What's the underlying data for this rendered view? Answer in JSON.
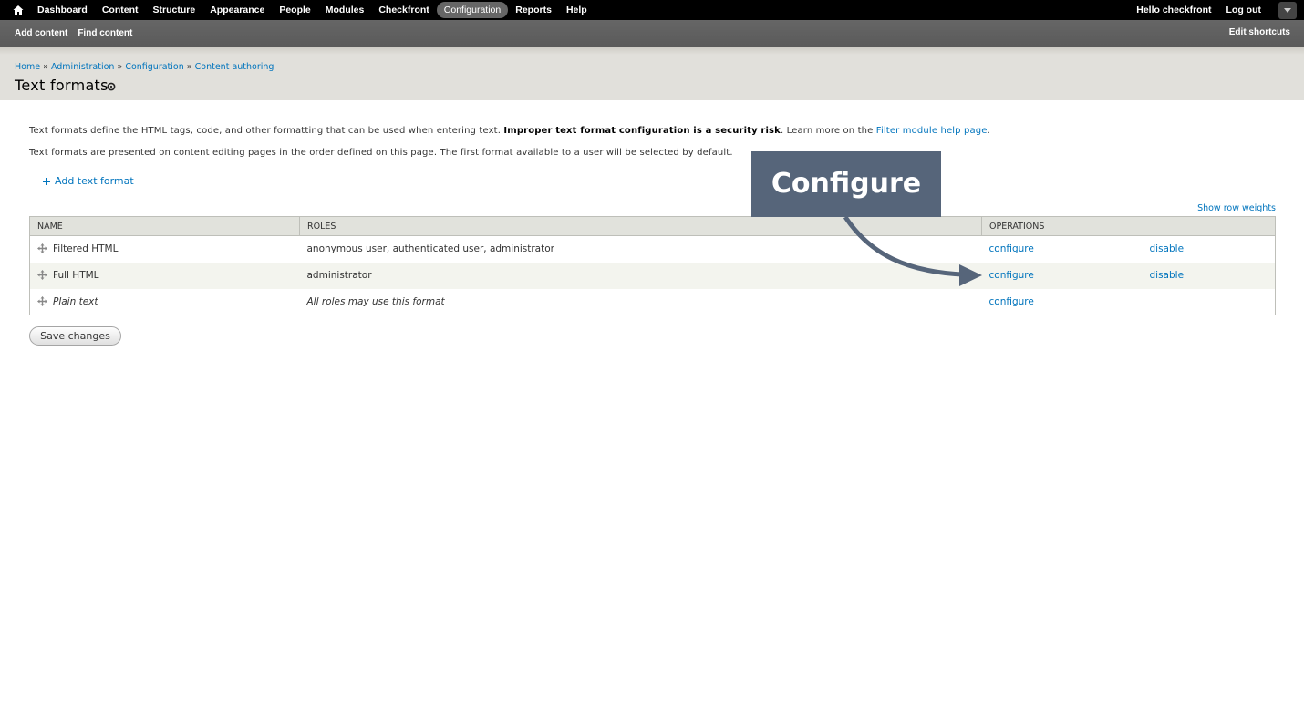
{
  "toolbar": {
    "menu": [
      "Dashboard",
      "Content",
      "Structure",
      "Appearance",
      "People",
      "Modules",
      "Checkfront",
      "Configuration",
      "Reports",
      "Help"
    ],
    "active": "Configuration",
    "hello_prefix": "Hello ",
    "username": "checkfront",
    "logout": "Log out"
  },
  "shortcuts": {
    "add_content": "Add content",
    "find_content": "Find content",
    "edit_shortcuts": "Edit shortcuts"
  },
  "breadcrumb": {
    "items": [
      "Home",
      "Administration",
      "Configuration",
      "Content authoring"
    ],
    "separator": "»"
  },
  "page_title": "Text formats",
  "description": {
    "line1_a": "Text formats define the HTML tags, code, and other formatting that can be used when entering text. ",
    "line1_bold": "Improper text format configuration is a security risk",
    "line1_b": ". Learn more on the ",
    "line1_link": "Filter module help page",
    "line1_c": ".",
    "line2": "Text formats are presented on content editing pages in the order defined on this page. The first format available to a user will be selected by default."
  },
  "add_text_format": "Add text format",
  "show_row_weights": "Show row weights",
  "table": {
    "headers": [
      "Name",
      "Roles",
      "Operations"
    ],
    "rows": [
      {
        "name": "Filtered HTML",
        "roles": "anonymous user, authenticated user, administrator",
        "op1": "configure",
        "op2": "disable"
      },
      {
        "name": "Full HTML",
        "roles": "administrator",
        "op1": "configure",
        "op2": "disable"
      },
      {
        "name": "Plain text",
        "roles": "All roles may use this format",
        "op1": "configure",
        "op2": ""
      }
    ]
  },
  "save_button": "Save changes",
  "callout": {
    "label": "Configure",
    "color": "#56657a"
  },
  "colors": {
    "link": "#0074bd",
    "toolbar_bg": "#000000",
    "shortcuts_bg": "#666666",
    "header_bg": "#e1e0db"
  }
}
